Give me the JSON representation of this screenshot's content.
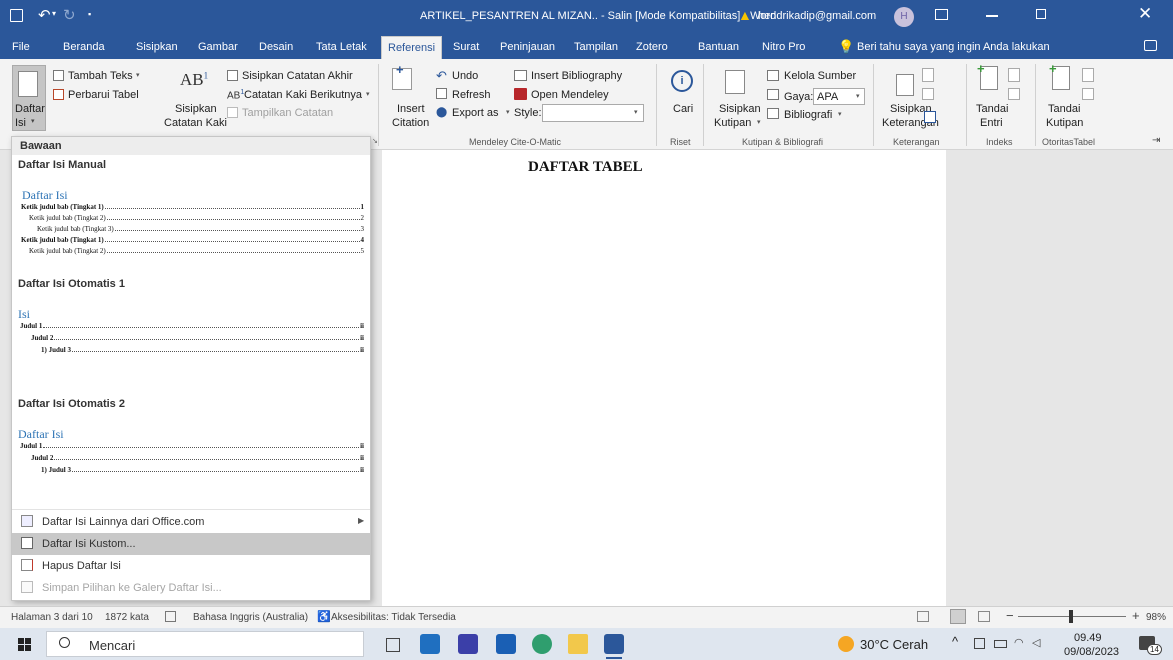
{
  "window": {
    "title": "ARTIKEL_PESANTREN AL MIZAN.. - Salin [Mode Kompatibilitas] - Word",
    "account": "hendrikadip@gmail.com",
    "avatar_initial": "H"
  },
  "tabs": [
    "File",
    "Beranda",
    "Sisipkan",
    "Gambar",
    "Desain",
    "Tata Letak",
    "Referensi",
    "Surat",
    "Peninjauan",
    "Tampilan",
    "Zotero",
    "Bantuan",
    "Nitro Pro"
  ],
  "active_tab": "Referensi",
  "tell_me": "Beri tahu saya yang ingin Anda lakukan",
  "ribbon": {
    "toc": {
      "line1": "Daftar",
      "line2": "Isi"
    },
    "add_text": "Tambah Teks",
    "update_table": "Perbarui Tabel",
    "insert_footnote": {
      "line1": "Sisipkan",
      "line2": "Catatan Kaki"
    },
    "insert_endnote": "Sisipkan Catatan Akhir",
    "next_footnote": "Catatan Kaki Berikutnya",
    "show_notes": "Tampilkan Catatan",
    "insert_citation": {
      "line1": "Insert",
      "line2": "Citation"
    },
    "undo": "Undo",
    "refresh": "Refresh",
    "export_as": "Export as",
    "insert_bibliography": "Insert Bibliography",
    "open_mendeley": "Open Mendeley",
    "style_label": "Style:",
    "style_value": "",
    "group_mendeley": "Mendeley Cite-O-Matic",
    "search": "Cari",
    "group_research": "Riset",
    "insert_citation_id": {
      "line1": "Sisipkan",
      "line2": "Kutipan"
    },
    "manage_sources": "Kelola Sumber",
    "style_word_label": "Gaya:",
    "style_word_value": "APA",
    "bibliography": "Bibliografi",
    "group_citations": "Kutipan & Bibliografi",
    "insert_caption": {
      "line1": "Sisipkan",
      "line2": "Keterangan"
    },
    "group_captions": "Keterangan",
    "mark_entry": {
      "line1": "Tandai",
      "line2": "Entri"
    },
    "group_index": "Indeks",
    "mark_citation": {
      "line1": "Tandai",
      "line2": "Kutipan"
    },
    "group_toa": "OtoritasTabel"
  },
  "gallery": {
    "header": "Bawaan",
    "manual": {
      "section": "Daftar Isi Manual",
      "title": "Daftar Isi",
      "rows": [
        {
          "text": "Ketik judul bab (Tingkat 1)",
          "page": "1",
          "level": 1
        },
        {
          "text": "Ketik judul bab (Tingkat 2)",
          "page": "2",
          "level": 2
        },
        {
          "text": "Ketik judul bab (Tingkat 3)",
          "page": "3",
          "level": 3
        },
        {
          "text": "Ketik judul bab (Tingkat 1)",
          "page": "4",
          "level": 1
        },
        {
          "text": "Ketik judul bab (Tingkat 2)",
          "page": "5",
          "level": 2
        }
      ]
    },
    "auto1": {
      "section": "Daftar Isi Otomatis 1",
      "title": "Isi",
      "rows": [
        {
          "text": "Judul 1",
          "page": "ii",
          "level": 1
        },
        {
          "text": "Judul 2",
          "page": "ii",
          "level": 2
        },
        {
          "text": "1)  Judul 3",
          "page": "ii",
          "level": 3
        }
      ]
    },
    "auto2": {
      "section": "Daftar Isi Otomatis 2",
      "title": "Daftar Isi",
      "rows": [
        {
          "text": "Judul 1",
          "page": "ii",
          "level": 1
        },
        {
          "text": "Judul 2",
          "page": "ii",
          "level": 2
        },
        {
          "text": "1)  Judul 3",
          "page": "ii",
          "level": 3
        }
      ]
    },
    "menu": [
      {
        "label": "Daftar Isi Lainnya dari Office.com",
        "state": "normal",
        "submenu": true
      },
      {
        "label": "Daftar Isi Kustom...",
        "state": "selected",
        "submenu": false
      },
      {
        "label": "Hapus Daftar Isi",
        "state": "normal",
        "submenu": false
      },
      {
        "label": "Simpan Pilihan ke Galery Daftar Isi...",
        "state": "disabled",
        "submenu": false
      }
    ]
  },
  "document": {
    "heading": "DAFTAR TABEL"
  },
  "status": {
    "page": "Halaman 3 dari 10",
    "words": "1872 kata",
    "language": "Bahasa Inggris (Australia)",
    "accessibility": "Aksesibilitas: Tidak Tersedia",
    "zoom_percent": 98
  },
  "taskbar": {
    "search": "Mencari",
    "weather": "30°C  Cerah",
    "time": "09.49",
    "date": "09/08/2023",
    "notification_count": "14"
  },
  "colors": {
    "word_blue": "#2b579a",
    "ribbon_bg": "#f3f3f3",
    "heading_blue": "#2e74b5"
  }
}
